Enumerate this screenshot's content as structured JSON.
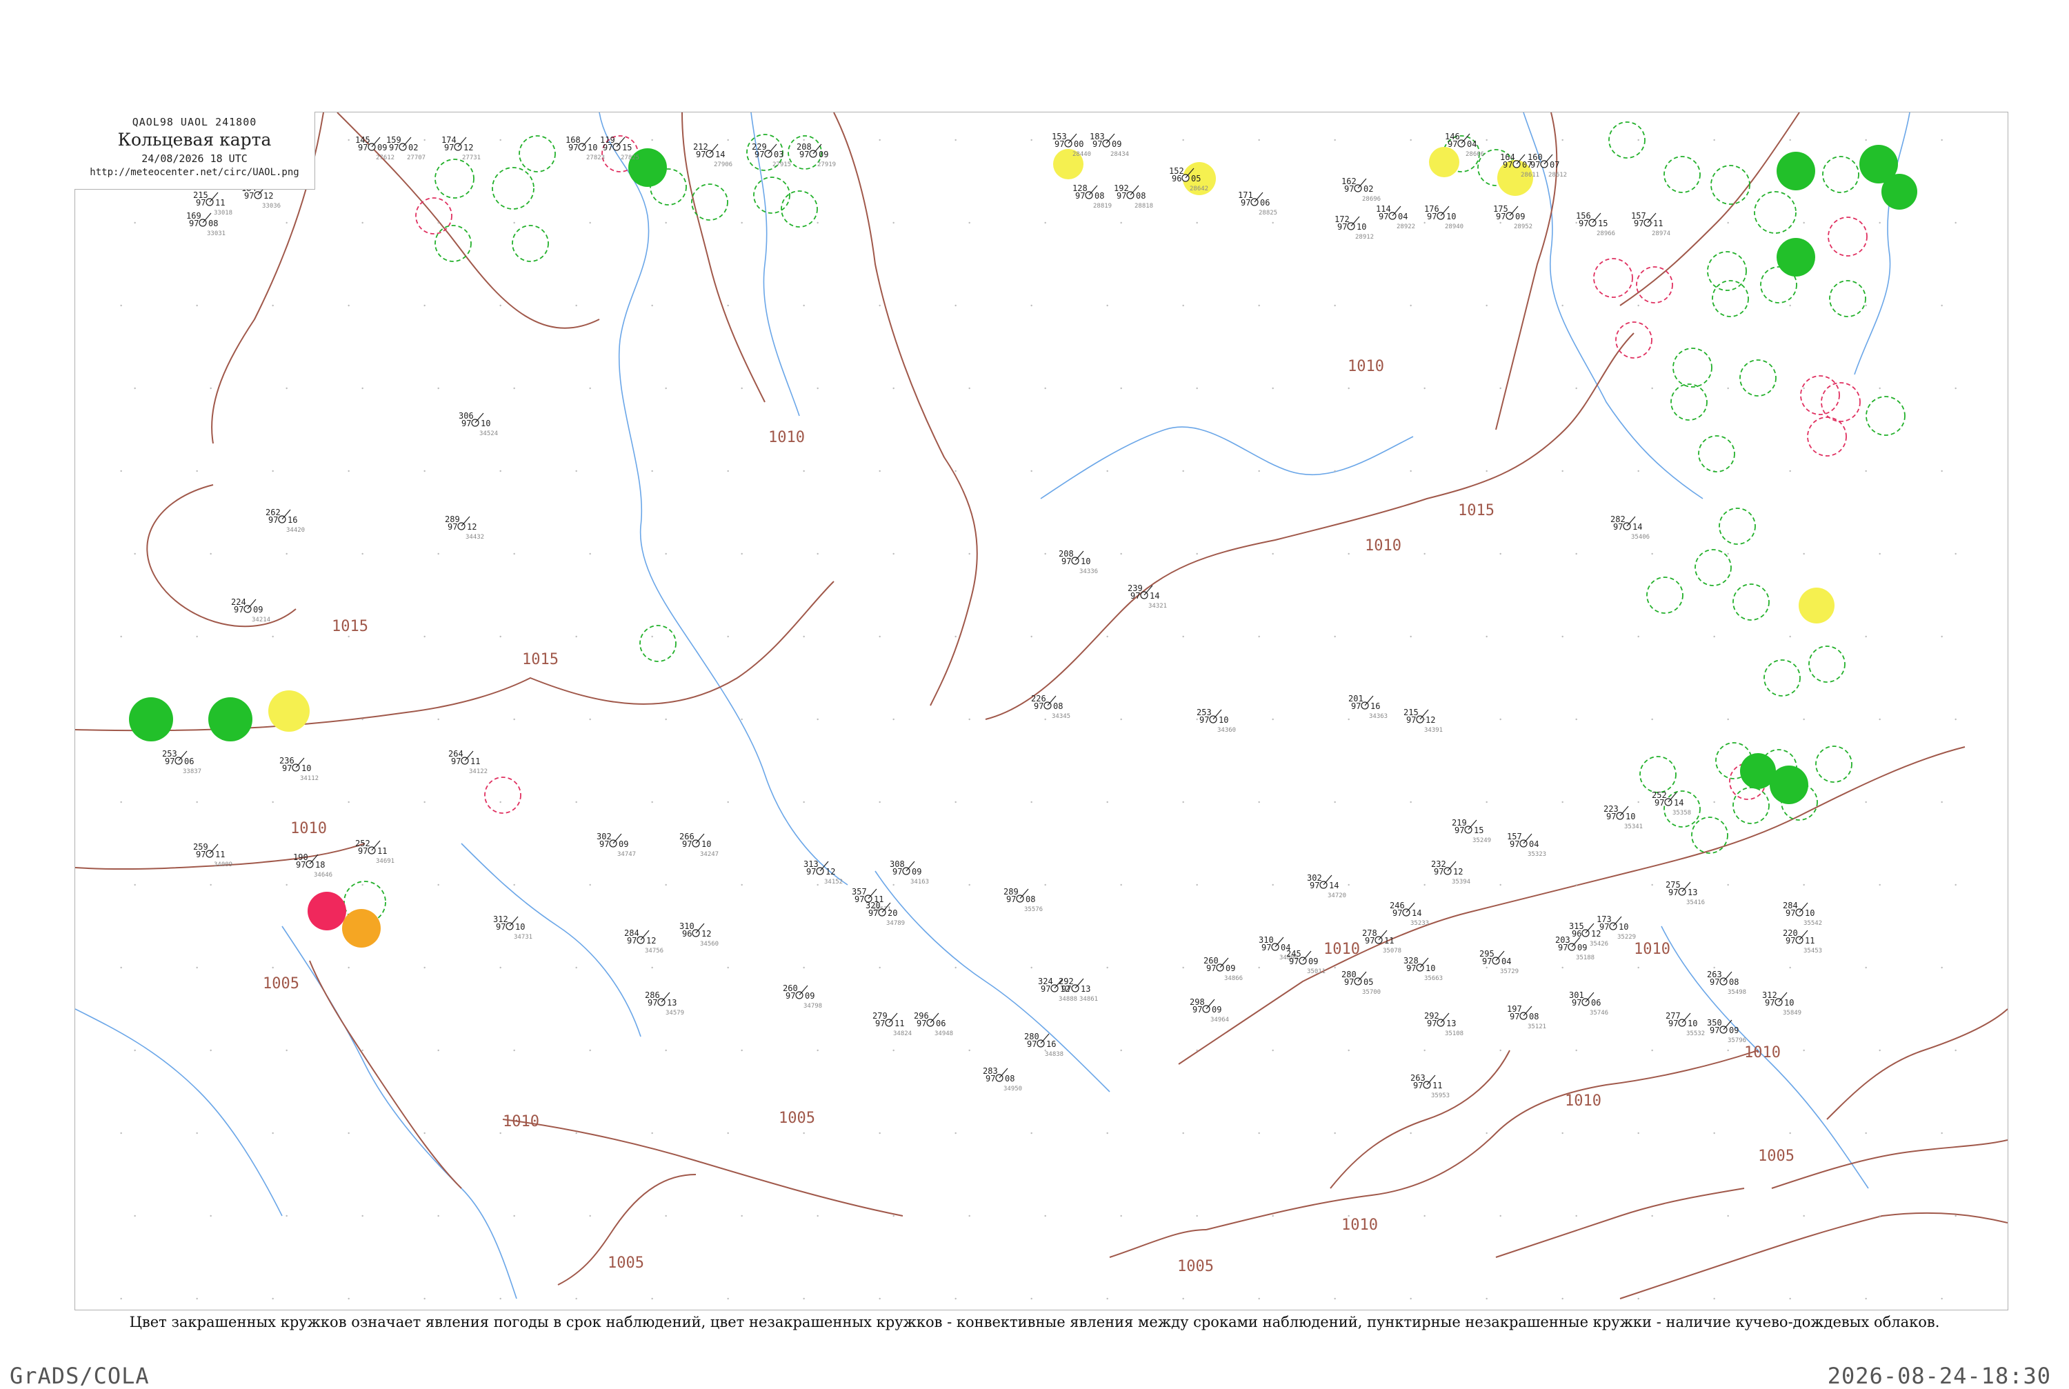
{
  "header": {
    "codes": "QAOL98  UAOL  241800",
    "title": "Кольцевая карта",
    "datetime": "24/08/2026 18 UTC",
    "url": "http://meteocenter.net/circ/UAOL.png"
  },
  "caption": "Цвет закрашенных кружков означает явления погоды в срок наблюдений, цвет незакрашенных кружков - конвективные явления между сроками наблюдений, пунктирные незакрашенные кружки - наличие кучево-дождевых облаков.",
  "footer": {
    "left": "GrADS/COLA",
    "right": "2026-08-24-18:30"
  },
  "colors": {
    "isobar": "#a0584a",
    "river": "#6aa6e8",
    "rain_fill": "#22c02a",
    "thunder_fill": "#f0285c",
    "dust_fill": "#f5a623",
    "haze_fill": "#f5f050",
    "ring_green": "#22b02a",
    "ring_red": "#e03060"
  },
  "isobar_labels": [
    {
      "text": "1010",
      "id": "iso-1010-a"
    },
    {
      "text": "1010",
      "id": "iso-1010-b"
    },
    {
      "text": "1015",
      "id": "iso-1015-a"
    },
    {
      "text": "1015",
      "id": "iso-1015-b"
    },
    {
      "text": "1010",
      "id": "iso-1010-c"
    },
    {
      "text": "1010",
      "id": "iso-1010-d"
    },
    {
      "text": "1005",
      "id": "iso-1005-a"
    },
    {
      "text": "1010",
      "id": "iso-1010-e"
    },
    {
      "text": "1005",
      "id": "iso-1005-b"
    },
    {
      "text": "1010",
      "id": "iso-1010-f"
    },
    {
      "text": "1005",
      "id": "iso-1005-c"
    },
    {
      "text": "1010",
      "id": "iso-1010-g"
    },
    {
      "text": "1010",
      "id": "iso-1010-h"
    },
    {
      "text": "1015",
      "id": "iso-1015-c"
    },
    {
      "text": "1010",
      "id": "iso-1010-i"
    },
    {
      "text": "1005",
      "id": "iso-1005-d"
    },
    {
      "text": "1010",
      "id": "iso-1010-j"
    },
    {
      "text": "1005",
      "id": "iso-1005-e"
    },
    {
      "text": "1005",
      "id": "iso-1005-f"
    }
  ],
  "stations": [
    {
      "p": "145",
      "t": "97",
      "d": "09",
      "code": "27612"
    },
    {
      "p": "159",
      "t": "97",
      "d": "02",
      "code": "27707"
    },
    {
      "p": "174",
      "t": "97",
      "d": "12",
      "code": "27731"
    },
    {
      "p": "168",
      "t": "97",
      "d": "10",
      "code": "27823"
    },
    {
      "p": "119",
      "t": "97",
      "d": "15",
      "code": "27825"
    },
    {
      "p": "212",
      "t": "97",
      "d": "14",
      "code": "27906"
    },
    {
      "p": "229",
      "t": "97",
      "d": "03",
      "code": "27915"
    },
    {
      "p": "208",
      "t": "97",
      "d": "09",
      "code": "27919"
    },
    {
      "p": "153",
      "t": "97",
      "d": "00",
      "code": "28440"
    },
    {
      "p": "183",
      "t": "97",
      "d": "09",
      "code": "28434"
    },
    {
      "p": "146",
      "t": "97",
      "d": "04",
      "code": "28606"
    },
    {
      "p": "164",
      "t": "97",
      "d": "07",
      "code": "28611"
    },
    {
      "p": "160",
      "t": "97",
      "d": "07",
      "code": "28612"
    },
    {
      "p": "152",
      "t": "96",
      "d": "05",
      "code": "28642"
    },
    {
      "p": "162",
      "t": "97",
      "d": "02",
      "code": "28696"
    },
    {
      "p": "193",
      "t": "97",
      "d": "09",
      "code": "33008"
    },
    {
      "p": "215",
      "t": "97",
      "d": "11",
      "code": "33018"
    },
    {
      "p": "169",
      "t": "97",
      "d": "08",
      "code": "33031"
    },
    {
      "p": "184",
      "t": "97",
      "d": "12",
      "code": "33036"
    },
    {
      "p": "128",
      "t": "97",
      "d": "08",
      "code": "28819"
    },
    {
      "p": "192",
      "t": "97",
      "d": "08",
      "code": "28818"
    },
    {
      "p": "171",
      "t": "97",
      "d": "06",
      "code": "28825"
    },
    {
      "p": "172",
      "t": "97",
      "d": "10",
      "code": "28912"
    },
    {
      "p": "114",
      "t": "97",
      "d": "04",
      "code": "28922"
    },
    {
      "p": "176",
      "t": "97",
      "d": "10",
      "code": "28940"
    },
    {
      "p": "175",
      "t": "97",
      "d": "09",
      "code": "28952"
    },
    {
      "p": "156",
      "t": "97",
      "d": "15",
      "code": "28966"
    },
    {
      "p": "157",
      "t": "97",
      "d": "11",
      "code": "28974"
    },
    {
      "p": "253",
      "t": "97",
      "d": "06",
      "code": "33837"
    },
    {
      "p": "278",
      "t": "97",
      "d": "08",
      "code": "34004"
    },
    {
      "p": "259",
      "t": "97",
      "d": "11",
      "code": "34009"
    },
    {
      "p": "236",
      "t": "97",
      "d": "10",
      "code": "34112"
    },
    {
      "p": "264",
      "t": "97",
      "d": "11",
      "code": "34122"
    },
    {
      "p": "313",
      "t": "97",
      "d": "12",
      "code": "34152"
    },
    {
      "p": "308",
      "t": "97",
      "d": "09",
      "code": "34163"
    },
    {
      "p": "224",
      "t": "97",
      "d": "09",
      "code": "34214"
    },
    {
      "p": "266",
      "t": "97",
      "d": "10",
      "code": "34247"
    },
    {
      "p": "239",
      "t": "97",
      "d": "14",
      "code": "34321"
    },
    {
      "p": "208",
      "t": "97",
      "d": "10",
      "code": "34336"
    },
    {
      "p": "226",
      "t": "97",
      "d": "08",
      "code": "34345"
    },
    {
      "p": "253",
      "t": "97",
      "d": "10",
      "code": "34360"
    },
    {
      "p": "201",
      "t": "97",
      "d": "16",
      "code": "34363"
    },
    {
      "p": "215",
      "t": "97",
      "d": "12",
      "code": "34391"
    },
    {
      "p": "262",
      "t": "97",
      "d": "16",
      "code": "34420"
    },
    {
      "p": "289",
      "t": "97",
      "d": "12",
      "code": "34432"
    },
    {
      "p": "306",
      "t": "97",
      "d": "10",
      "code": "34524"
    },
    {
      "p": "310",
      "t": "96",
      "d": "12",
      "code": "34560"
    },
    {
      "p": "357",
      "t": "97",
      "d": "11",
      "code": "34571"
    },
    {
      "p": "286",
      "t": "97",
      "d": "13",
      "code": "34579"
    },
    {
      "p": "190",
      "t": "97",
      "d": "18",
      "code": "34646"
    },
    {
      "p": "252",
      "t": "97",
      "d": "11",
      "code": "34691"
    },
    {
      "p": "302",
      "t": "97",
      "d": "14",
      "code": "34720"
    },
    {
      "p": "312",
      "t": "97",
      "d": "10",
      "code": "34731"
    },
    {
      "p": "302",
      "t": "97",
      "d": "09",
      "code": "34747"
    },
    {
      "p": "284",
      "t": "97",
      "d": "12",
      "code": "34756"
    },
    {
      "p": "320",
      "t": "97",
      "d": "20",
      "code": "34789"
    },
    {
      "p": "260",
      "t": "97",
      "d": "09",
      "code": "34798"
    },
    {
      "p": "279",
      "t": "97",
      "d": "11",
      "code": "34824"
    },
    {
      "p": "280",
      "t": "97",
      "d": "16",
      "code": "34838"
    },
    {
      "p": "292",
      "t": "97",
      "d": "13",
      "code": "34861"
    },
    {
      "p": "260",
      "t": "97",
      "d": "09",
      "code": "34866"
    },
    {
      "p": "310",
      "t": "97",
      "d": "04",
      "code": "34880"
    },
    {
      "p": "324",
      "t": "97",
      "d": "12",
      "code": "34888"
    },
    {
      "p": "296",
      "t": "97",
      "d": "06",
      "code": "34948"
    },
    {
      "p": "283",
      "t": "97",
      "d": "08",
      "code": "34950"
    },
    {
      "p": "298",
      "t": "97",
      "d": "09",
      "code": "34964"
    },
    {
      "p": "245",
      "t": "97",
      "d": "09",
      "code": "35011"
    },
    {
      "p": "278",
      "t": "97",
      "d": "11",
      "code": "35078"
    },
    {
      "p": "292",
      "t": "97",
      "d": "13",
      "code": "35108"
    },
    {
      "p": "197",
      "t": "97",
      "d": "08",
      "code": "35121"
    },
    {
      "p": "203",
      "t": "97",
      "d": "09",
      "code": "35188"
    },
    {
      "p": "173",
      "t": "97",
      "d": "10",
      "code": "35229"
    },
    {
      "p": "246",
      "t": "97",
      "d": "14",
      "code": "35233"
    },
    {
      "p": "219",
      "t": "97",
      "d": "15",
      "code": "35249"
    },
    {
      "p": "157",
      "t": "97",
      "d": "04",
      "code": "35323"
    },
    {
      "p": "223",
      "t": "97",
      "d": "10",
      "code": "35341"
    },
    {
      "p": "252",
      "t": "97",
      "d": "14",
      "code": "35358"
    },
    {
      "p": "232",
      "t": "97",
      "d": "12",
      "code": "35394"
    },
    {
      "p": "282",
      "t": "97",
      "d": "14",
      "code": "35406"
    },
    {
      "p": "275",
      "t": "97",
      "d": "13",
      "code": "35416"
    },
    {
      "p": "315",
      "t": "96",
      "d": "12",
      "code": "35426"
    },
    {
      "p": "220",
      "t": "97",
      "d": "11",
      "code": "35453"
    },
    {
      "p": "263",
      "t": "97",
      "d": "08",
      "code": "35498"
    },
    {
      "p": "277",
      "t": "97",
      "d": "10",
      "code": "35532"
    },
    {
      "p": "284",
      "t": "97",
      "d": "10",
      "code": "35542"
    },
    {
      "p": "289",
      "t": "97",
      "d": "08",
      "code": "35576"
    },
    {
      "p": "328",
      "t": "97",
      "d": "10",
      "code": "35663"
    },
    {
      "p": "280",
      "t": "97",
      "d": "05",
      "code": "35700"
    },
    {
      "p": "295",
      "t": "97",
      "d": "04",
      "code": "35729"
    },
    {
      "p": "301",
      "t": "97",
      "d": "06",
      "code": "35746"
    },
    {
      "p": "350",
      "t": "97",
      "d": "09",
      "code": "35796"
    },
    {
      "p": "312",
      "t": "97",
      "d": "10",
      "code": "35849"
    },
    {
      "p": "263",
      "t": "97",
      "d": "11",
      "code": "35953"
    }
  ],
  "legend_symbols": [
    {
      "name": "rain",
      "label": ""
    },
    {
      "name": "thunderstorm",
      "label": ""
    },
    {
      "name": "dust",
      "label": ""
    },
    {
      "name": "haze",
      "label": ""
    }
  ]
}
